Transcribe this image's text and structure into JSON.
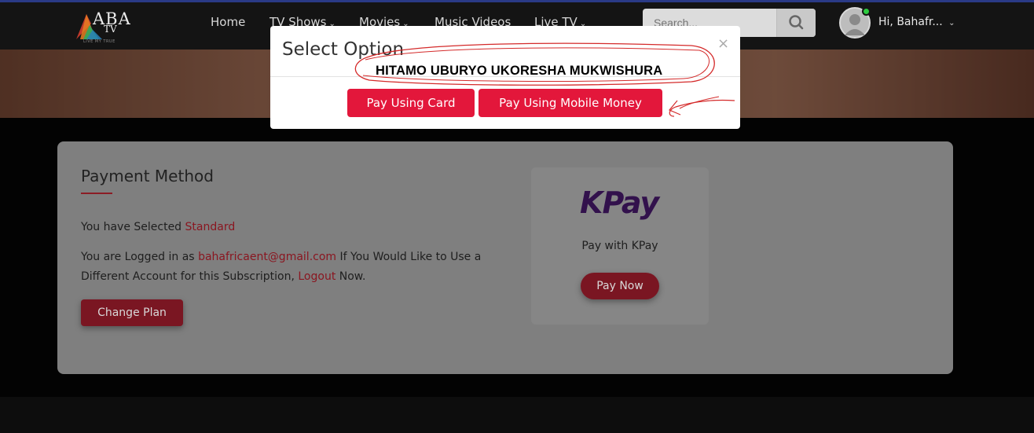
{
  "header": {
    "logo_text": "ABA",
    "logo_sub": "TV",
    "logo_tag": "LIVE MY TRUE",
    "nav": [
      {
        "label": "Home",
        "caret": ""
      },
      {
        "label": "TV Shows",
        "caret": "⌄"
      },
      {
        "label": "Movies",
        "caret": "⌄"
      },
      {
        "label": "Music Videos",
        "caret": ""
      },
      {
        "label": "Live TV",
        "caret": "⌄"
      }
    ],
    "search_placeholder": "Search...",
    "user_greeting": "Hi, Bahafr...",
    "user_caret": "⌄"
  },
  "payment": {
    "title": "Payment Method",
    "selected_prefix": "You have Selected ",
    "selected_plan": "Standard",
    "logged_prefix": "You are Logged in as ",
    "email": "bahafricaent@gmail.com",
    "logged_middle": " If You Would Like to Use a Different Account for this Subscription, ",
    "logout": "Logout",
    "logged_suffix": " Now.",
    "change_plan": "Change Plan"
  },
  "kpay": {
    "logo": "KPay",
    "caption": "Pay with KPay",
    "pay_now": "Pay Now"
  },
  "modal": {
    "title": "Select Option",
    "close": "×",
    "annotation": "HITAMO UBURYO UKORESHA MUKWISHURA",
    "pay_card": "Pay Using Card",
    "pay_mobile": "Pay Using Mobile Money"
  },
  "colors": {
    "accent": "#e3173b",
    "dim_accent": "#7a1622",
    "header_bg": "#141414"
  }
}
